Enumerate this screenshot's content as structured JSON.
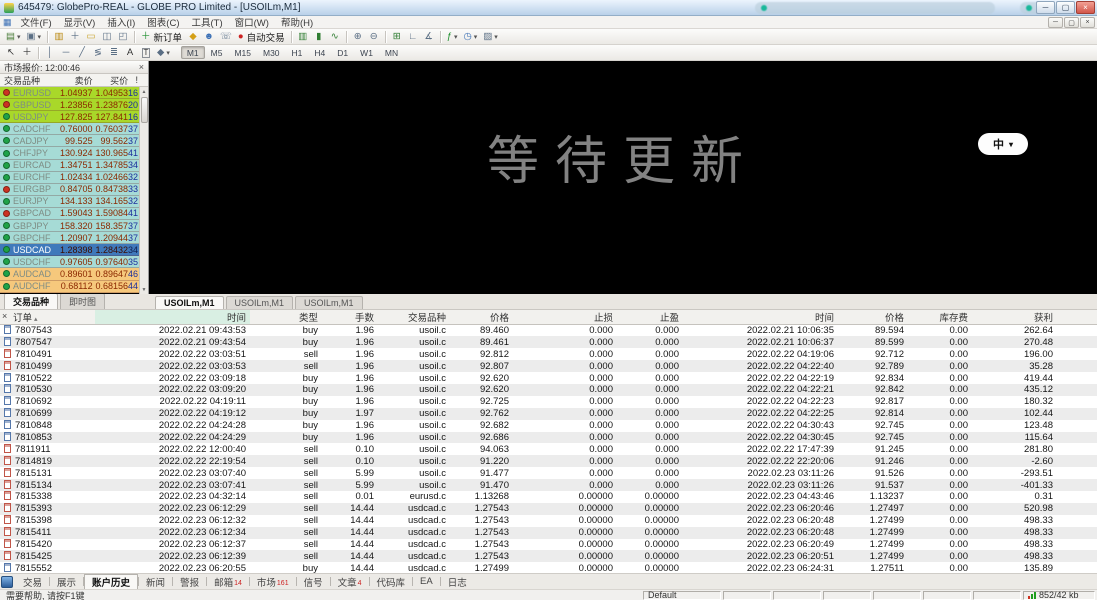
{
  "window": {
    "title": "645479: GlobePro-REAL - GLOBE PRO Limited - [USOILm,M1]"
  },
  "icons": {
    "minimize": "─",
    "restore": "▢",
    "close": "×",
    "caret_down": "▾",
    "sort_asc": "▴",
    "scroll_up": "▲",
    "scroll_down": "▼",
    "child_window": "▦"
  },
  "menu": {
    "items": [
      "文件(F)",
      "显示(V)",
      "插入(I)",
      "图表(C)",
      "工具(T)",
      "窗口(W)",
      "帮助(H)"
    ]
  },
  "toolbar_standard": {
    "items": [
      {
        "name": "new-chart-button",
        "glyph": "▤",
        "caret": true,
        "color": "#4a7d3a"
      },
      {
        "name": "profiles-button",
        "glyph": "▣",
        "caret": true,
        "color": "#5a6e84"
      },
      {
        "type": "sep"
      },
      {
        "name": "market-watch-button",
        "glyph": "▥",
        "color": "#b8860b"
      },
      {
        "name": "data-window-button",
        "glyph": "＋",
        "color": "#5a6e84"
      },
      {
        "name": "navigator-button",
        "glyph": "▭",
        "color": "#c9a227"
      },
      {
        "name": "terminal-button",
        "glyph": "◫",
        "color": "#5a6e84"
      },
      {
        "name": "strategy-tester-button",
        "glyph": "◰",
        "color": "#5a6e84"
      },
      {
        "type": "sep"
      },
      {
        "name": "new-order-button",
        "glyph": "＋",
        "label": "新订单",
        "color": "#1e8f2e"
      },
      {
        "name": "metaeditor-button",
        "glyph": "◆",
        "color": "#d4a017"
      },
      {
        "name": "community-button",
        "glyph": "☻",
        "color": "#3a6fb5"
      },
      {
        "name": "support-button",
        "glyph": "☏",
        "color": "#6a7f95"
      },
      {
        "name": "auto-trading-button",
        "glyph": "●",
        "label": "自动交易",
        "color": "#cc2222"
      },
      {
        "type": "sep"
      },
      {
        "name": "bar-chart-button",
        "glyph": "▥",
        "color": "#2f7d32"
      },
      {
        "name": "candlestick-button",
        "glyph": "▮",
        "color": "#2f7d32"
      },
      {
        "name": "line-chart-button",
        "glyph": "∿",
        "color": "#2f7d32"
      },
      {
        "type": "sep"
      },
      {
        "name": "zoom-in-button",
        "glyph": "⊕",
        "color": "#5a6e84"
      },
      {
        "name": "zoom-out-button",
        "glyph": "⊖",
        "color": "#5a6e84"
      },
      {
        "type": "sep"
      },
      {
        "name": "arrange-windows-button",
        "glyph": "⊞",
        "color": "#2f7d32"
      },
      {
        "name": "auto-scale-button",
        "glyph": "∟",
        "color": "#5a6e84"
      },
      {
        "name": "fixed-scale-button",
        "glyph": "∡",
        "color": "#5a6e84"
      },
      {
        "type": "sep"
      },
      {
        "name": "indicators-button",
        "glyph": "ƒ",
        "caret": true,
        "color": "#1e8f2e"
      },
      {
        "name": "periods-button",
        "glyph": "◷",
        "caret": true,
        "color": "#3a6fb5"
      },
      {
        "name": "templates-button",
        "glyph": "▨",
        "caret": true,
        "color": "#5a6e84"
      }
    ]
  },
  "toolbar_charts": {
    "items": [
      {
        "name": "cursor-tool",
        "glyph": "↖",
        "color": "#333333"
      },
      {
        "name": "crosshair-tool",
        "glyph": "＋",
        "color": "#333333"
      },
      {
        "type": "sep"
      },
      {
        "name": "vertical-line-tool",
        "glyph": "│",
        "color": "#5a6e84"
      },
      {
        "name": "horizontal-line-tool",
        "glyph": "─",
        "color": "#5a6e84"
      },
      {
        "name": "trendline-tool",
        "glyph": "╱",
        "color": "#5a6e84"
      },
      {
        "name": "fibonacci-tool",
        "glyph": "≶",
        "color": "#5a6e84"
      },
      {
        "name": "channels-tool",
        "glyph": "≣",
        "color": "#5a6e84"
      },
      {
        "name": "text-tool",
        "glyph": "A",
        "color": "#333333"
      },
      {
        "name": "label-tool",
        "glyph": "T",
        "color": "#333333",
        "boxed": true
      },
      {
        "name": "shapes-tool",
        "glyph": "◆",
        "caret": true,
        "color": "#5a6e84"
      }
    ],
    "timeframes": [
      "M1",
      "M5",
      "M15",
      "M30",
      "H1",
      "H4",
      "D1",
      "W1",
      "MN"
    ],
    "active_timeframe": "M1"
  },
  "market_watch": {
    "title": "市场报价: 12:00:46",
    "columns": [
      "交易品种",
      "卖价",
      "买价",
      "!"
    ],
    "tabs": [
      "交易品种",
      "即时图"
    ],
    "active_tab": "交易品种",
    "group_colors": {
      "green": "#a9d829",
      "cyan": "#a6dbd6",
      "selected": "#3f79bb",
      "orange": "#f6c87c"
    },
    "trend_colors": {
      "up": "#1fa348",
      "down": "#cc3322"
    },
    "symbol_color": "#7e8c84",
    "symbol_color_selected": "#ffffff",
    "bid_ask_color": "#8b2800",
    "spread_color": "#1c2f9c",
    "rows": [
      {
        "symbol": "EURUSD",
        "bid": "1.04937",
        "ask": "1.04953",
        "spread": "16",
        "group": "green",
        "trend": "down"
      },
      {
        "symbol": "GBPUSD",
        "bid": "1.23856",
        "ask": "1.23876",
        "spread": "20",
        "group": "green",
        "trend": "down"
      },
      {
        "symbol": "USDJPY",
        "bid": "127.825",
        "ask": "127.841",
        "spread": "16",
        "group": "green",
        "trend": "up"
      },
      {
        "symbol": "CADCHF",
        "bid": "0.76000",
        "ask": "0.76037",
        "spread": "37",
        "group": "cyan",
        "trend": "up"
      },
      {
        "symbol": "CADJPY",
        "bid": "99.525",
        "ask": "99.562",
        "spread": "37",
        "group": "cyan",
        "trend": "up"
      },
      {
        "symbol": "CHFJPY",
        "bid": "130.924",
        "ask": "130.965",
        "spread": "41",
        "group": "cyan",
        "trend": "up"
      },
      {
        "symbol": "EURCAD",
        "bid": "1.34751",
        "ask": "1.34785",
        "spread": "34",
        "group": "cyan",
        "trend": "up"
      },
      {
        "symbol": "EURCHF",
        "bid": "1.02434",
        "ask": "1.02466",
        "spread": "32",
        "group": "cyan",
        "trend": "up"
      },
      {
        "symbol": "EURGBP",
        "bid": "0.84705",
        "ask": "0.84738",
        "spread": "33",
        "group": "cyan",
        "trend": "down"
      },
      {
        "symbol": "EURJPY",
        "bid": "134.133",
        "ask": "134.165",
        "spread": "32",
        "group": "cyan",
        "trend": "up"
      },
      {
        "symbol": "GBPCAD",
        "bid": "1.59043",
        "ask": "1.59084",
        "spread": "41",
        "group": "cyan",
        "trend": "down"
      },
      {
        "symbol": "GBPJPY",
        "bid": "158.320",
        "ask": "158.357",
        "spread": "37",
        "group": "cyan",
        "trend": "up"
      },
      {
        "symbol": "GBPCHF",
        "bid": "1.20907",
        "ask": "1.20944",
        "spread": "37",
        "group": "cyan",
        "trend": "up"
      },
      {
        "symbol": "USDCAD",
        "bid": "1.28398",
        "ask": "1.28432",
        "spread": "34",
        "group": "selected",
        "trend": "up"
      },
      {
        "symbol": "USDCHF",
        "bid": "0.97605",
        "ask": "0.97640",
        "spread": "35",
        "group": "cyan",
        "trend": "up"
      },
      {
        "symbol": "AUDCAD",
        "bid": "0.89601",
        "ask": "0.89647",
        "spread": "46",
        "group": "orange",
        "trend": "up"
      },
      {
        "symbol": "AUDCHF",
        "bid": "0.68112",
        "ask": "0.68156",
        "spread": "44",
        "group": "orange",
        "trend": "up"
      }
    ]
  },
  "chart": {
    "watermark": "等待更新",
    "overlay_label": "中",
    "tabs": [
      "USOILm,M1",
      "USOILm,M1",
      "USOILm,M1"
    ],
    "active_tab_index": 0
  },
  "history": {
    "columns": [
      "订单",
      "时间",
      "类型",
      "手数",
      "交易品种",
      "价格",
      "止损",
      "止盈",
      "时间",
      "价格",
      "库存费",
      "获利"
    ],
    "type_icon_colors": {
      "buy": "#5577aa",
      "sell": "#c05548"
    },
    "rows": [
      [
        "7807543",
        "2022.02.21 09:43:53",
        "buy",
        "1.96",
        "usoil.c",
        "89.460",
        "0.000",
        "0.000",
        "2022.02.21 10:06:35",
        "89.594",
        "0.00",
        "262.64"
      ],
      [
        "7807547",
        "2022.02.21 09:43:54",
        "buy",
        "1.96",
        "usoil.c",
        "89.461",
        "0.000",
        "0.000",
        "2022.02.21 10:06:37",
        "89.599",
        "0.00",
        "270.48"
      ],
      [
        "7810491",
        "2022.02.22 03:03:51",
        "sell",
        "1.96",
        "usoil.c",
        "92.812",
        "0.000",
        "0.000",
        "2022.02.22 04:19:06",
        "92.712",
        "0.00",
        "196.00"
      ],
      [
        "7810499",
        "2022.02.22 03:03:53",
        "sell",
        "1.96",
        "usoil.c",
        "92.807",
        "0.000",
        "0.000",
        "2022.02.22 04:22:40",
        "92.789",
        "0.00",
        "35.28"
      ],
      [
        "7810522",
        "2022.02.22 03:09:18",
        "buy",
        "1.96",
        "usoil.c",
        "92.620",
        "0.000",
        "0.000",
        "2022.02.22 04:22:19",
        "92.834",
        "0.00",
        "419.44"
      ],
      [
        "7810530",
        "2022.02.22 03:09:20",
        "buy",
        "1.96",
        "usoil.c",
        "92.620",
        "0.000",
        "0.000",
        "2022.02.22 04:22:21",
        "92.842",
        "0.00",
        "435.12"
      ],
      [
        "7810692",
        "2022.02.22 04:19:11",
        "buy",
        "1.96",
        "usoil.c",
        "92.725",
        "0.000",
        "0.000",
        "2022.02.22 04:22:23",
        "92.817",
        "0.00",
        "180.32"
      ],
      [
        "7810699",
        "2022.02.22 04:19:12",
        "buy",
        "1.97",
        "usoil.c",
        "92.762",
        "0.000",
        "0.000",
        "2022.02.22 04:22:25",
        "92.814",
        "0.00",
        "102.44"
      ],
      [
        "7810848",
        "2022.02.22 04:24:28",
        "buy",
        "1.96",
        "usoil.c",
        "92.682",
        "0.000",
        "0.000",
        "2022.02.22 04:30:43",
        "92.745",
        "0.00",
        "123.48"
      ],
      [
        "7810853",
        "2022.02.22 04:24:29",
        "buy",
        "1.96",
        "usoil.c",
        "92.686",
        "0.000",
        "0.000",
        "2022.02.22 04:30:45",
        "92.745",
        "0.00",
        "115.64"
      ],
      [
        "7811911",
        "2022.02.22 12:00:40",
        "sell",
        "0.10",
        "usoil.c",
        "94.063",
        "0.000",
        "0.000",
        "2022.02.22 17:47:39",
        "91.245",
        "0.00",
        "281.80"
      ],
      [
        "7814819",
        "2022.02.22 22:19:54",
        "sell",
        "0.10",
        "usoil.c",
        "91.220",
        "0.000",
        "0.000",
        "2022.02.22 22:20:06",
        "91.246",
        "0.00",
        "-2.60"
      ],
      [
        "7815131",
        "2022.02.23 03:07:40",
        "sell",
        "5.99",
        "usoil.c",
        "91.477",
        "0.000",
        "0.000",
        "2022.02.23 03:11:26",
        "91.526",
        "0.00",
        "-293.51"
      ],
      [
        "7815134",
        "2022.02.23 03:07:41",
        "sell",
        "5.99",
        "usoil.c",
        "91.470",
        "0.000",
        "0.000",
        "2022.02.23 03:11:26",
        "91.537",
        "0.00",
        "-401.33"
      ],
      [
        "7815338",
        "2022.02.23 04:32:14",
        "sell",
        "0.01",
        "eurusd.c",
        "1.13268",
        "0.00000",
        "0.00000",
        "2022.02.23 04:43:46",
        "1.13237",
        "0.00",
        "0.31"
      ],
      [
        "7815393",
        "2022.02.23 06:12:29",
        "sell",
        "14.44",
        "usdcad.c",
        "1.27543",
        "0.00000",
        "0.00000",
        "2022.02.23 06:20:46",
        "1.27497",
        "0.00",
        "520.98"
      ],
      [
        "7815398",
        "2022.02.23 06:12:32",
        "sell",
        "14.44",
        "usdcad.c",
        "1.27543",
        "0.00000",
        "0.00000",
        "2022.02.23 06:20:48",
        "1.27499",
        "0.00",
        "498.33"
      ],
      [
        "7815411",
        "2022.02.23 06:12:34",
        "sell",
        "14.44",
        "usdcad.c",
        "1.27543",
        "0.00000",
        "0.00000",
        "2022.02.23 06:20:48",
        "1.27499",
        "0.00",
        "498.33"
      ],
      [
        "7815420",
        "2022.02.23 06:12:37",
        "sell",
        "14.44",
        "usdcad.c",
        "1.27543",
        "0.00000",
        "0.00000",
        "2022.02.23 06:20:49",
        "1.27499",
        "0.00",
        "498.33"
      ],
      [
        "7815425",
        "2022.02.23 06:12:39",
        "sell",
        "14.44",
        "usdcad.c",
        "1.27543",
        "0.00000",
        "0.00000",
        "2022.02.23 06:20:51",
        "1.27499",
        "0.00",
        "498.33"
      ],
      [
        "7815552",
        "2022.02.23 06:20:55",
        "buy",
        "14.44",
        "usdcad.c",
        "1.27499",
        "0.00000",
        "0.00000",
        "2022.02.23 06:24:31",
        "1.27511",
        "0.00",
        "135.89"
      ]
    ]
  },
  "bottom_tabs": {
    "items": [
      {
        "label": "交易"
      },
      {
        "label": "展示"
      },
      {
        "label": "账户历史",
        "active": true
      },
      {
        "label": "新闻"
      },
      {
        "label": "警报"
      },
      {
        "label": "邮箱",
        "badge": "14"
      },
      {
        "label": "市场",
        "badge": "161"
      },
      {
        "label": "信号"
      },
      {
        "label": "文章",
        "badge": "4"
      },
      {
        "label": "代码库"
      },
      {
        "label": "EA"
      },
      {
        "label": "日志"
      }
    ]
  },
  "status_bar": {
    "help": "需要帮助, 请按F1键",
    "profile": "Default",
    "traffic": "852/42 kb",
    "bar_colors": [
      "#cc3322",
      "#1d9e1d",
      "#1d9e1d"
    ]
  }
}
